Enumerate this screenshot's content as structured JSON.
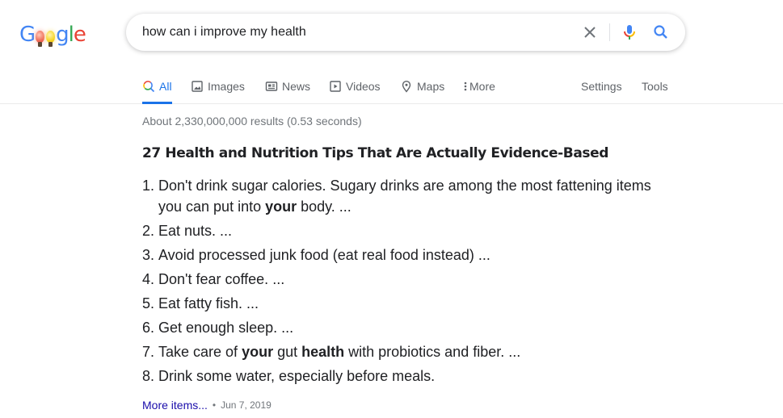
{
  "logo": {
    "text": "Google",
    "letters": [
      "G",
      "o",
      "o",
      "g",
      "l",
      "e"
    ]
  },
  "search": {
    "query": "how can i improve my health",
    "clear_label": "Clear",
    "mic_label": "Search by voice",
    "submit_label": "Search"
  },
  "tabs": [
    {
      "label": "All",
      "icon": "search-icon",
      "active": true
    },
    {
      "label": "Images",
      "icon": "image-icon",
      "active": false
    },
    {
      "label": "News",
      "icon": "news-icon",
      "active": false
    },
    {
      "label": "Videos",
      "icon": "video-play-icon",
      "active": false
    },
    {
      "label": "Maps",
      "icon": "map-pin-icon",
      "active": false
    },
    {
      "label": "More",
      "icon": "more-vert-icon",
      "active": false
    }
  ],
  "tools": {
    "settings": "Settings",
    "tools": "Tools"
  },
  "result_stats": "About 2,330,000,000 results (0.53 seconds)",
  "snippet": {
    "title": "27 Health and Nutrition Tips That Are Actually Evidence-Based",
    "items": [
      {
        "num": "1.",
        "parts": [
          {
            "t": "Don't drink sugar calories. Sugary drinks are among the most fattening items you can put into "
          },
          {
            "t": "your",
            "b": true
          },
          {
            "t": " body. ..."
          }
        ]
      },
      {
        "num": "2.",
        "parts": [
          {
            "t": "Eat nuts. ..."
          }
        ]
      },
      {
        "num": "3.",
        "parts": [
          {
            "t": "Avoid processed junk food (eat real food instead) ..."
          }
        ]
      },
      {
        "num": "4.",
        "parts": [
          {
            "t": "Don't fear coffee. ..."
          }
        ]
      },
      {
        "num": "5.",
        "parts": [
          {
            "t": "Eat fatty fish. ..."
          }
        ]
      },
      {
        "num": "6.",
        "parts": [
          {
            "t": "Get enough sleep. ..."
          }
        ]
      },
      {
        "num": "7.",
        "parts": [
          {
            "t": "Take care of "
          },
          {
            "t": "your",
            "b": true
          },
          {
            "t": " gut "
          },
          {
            "t": "health",
            "b": true
          },
          {
            "t": " with probiotics and fiber. ..."
          }
        ]
      },
      {
        "num": "8.",
        "parts": [
          {
            "t": "Drink some water, especially before meals."
          }
        ]
      }
    ],
    "more_items": "More items...",
    "separator": "•",
    "date": "Jun 7, 2019"
  },
  "colors": {
    "accent": "#1a73e8",
    "link": "#1a0dab",
    "muted": "#70757a"
  }
}
